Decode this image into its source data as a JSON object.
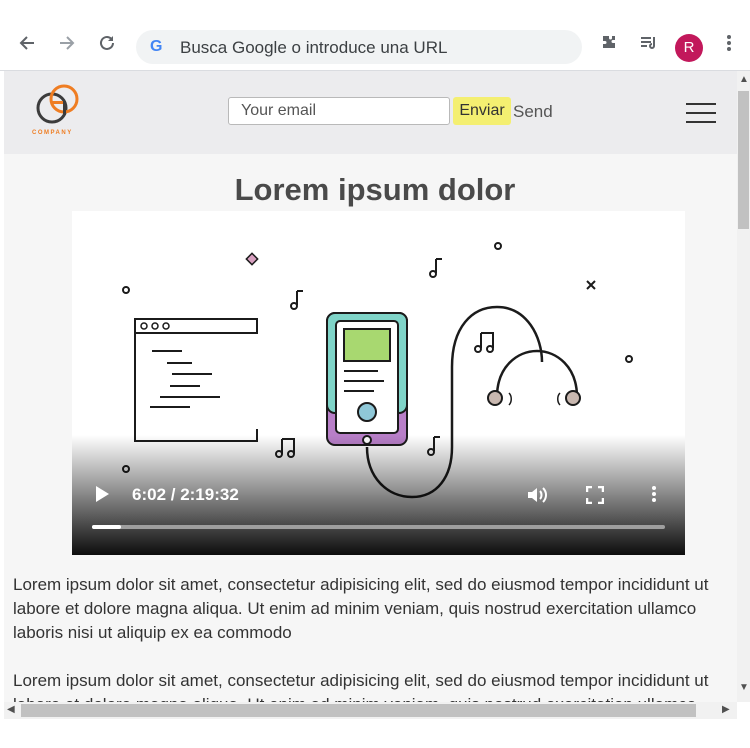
{
  "browser": {
    "address_placeholder": "Busca Google o introduce una URL",
    "google_glyph": "G",
    "profile_initial": "R",
    "icons": [
      "back-arrow-icon",
      "forward-arrow-icon",
      "reload-icon",
      "extensions-puzzle-icon",
      "media-queue-icon",
      "kebab-menu-icon"
    ]
  },
  "site": {
    "logo_text": "COMPANY",
    "email_placeholder": "Your email",
    "enviar_label": "Enviar",
    "send_label": "Send",
    "title": "Lorem ipsum dolor"
  },
  "video": {
    "time_display": "6:02 / 2:19:32",
    "progress": 0.05
  },
  "content": {
    "paragraph_1": "Lorem ipsum dolor sit amet, consectetur adipisicing elit, sed do eiusmod tempor incididunt ut labore et dolore magna aliqua. Ut enim ad minim veniam, quis nostrud exercitation ullamco laboris nisi ut aliquip ex ea commodo",
    "paragraph_2": "Lorem ipsum dolor sit amet, consectetur adipisicing elit, sed do eiusmod tempor incididunt ut labore et dolore magna aliqua. Ut enim ad minim veniam, quis nostrud exercitation ullamco laboris nisi ut aliquip ex ea commodo"
  },
  "colors": {
    "enviar_bg": "#f4ef71",
    "avatar": "#c2185b",
    "logo_orange": "#ef7d22",
    "logo_dark": "#3c3c3c"
  }
}
